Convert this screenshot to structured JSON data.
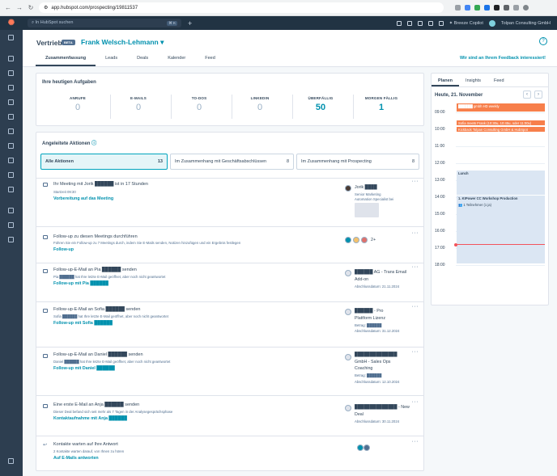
{
  "browser": {
    "url": "app.hubspot.com/prospecting/19811537"
  },
  "topbar": {
    "search_placeholder": "In HubSpot suchen",
    "search_kbd": "⌘ K",
    "copilot": "Breeze Copilot",
    "account": "Tolpan Consulting GmbH"
  },
  "header": {
    "title": "Vertrieb",
    "beta": "BETA",
    "owner": "Frank Welsch-Lehmann",
    "help": "?",
    "feedback": "Wir sind an Ihrem Feedback interessiert!",
    "tabs": [
      "Zusammenfassung",
      "Leads",
      "Deals",
      "Kalender",
      "Feed"
    ]
  },
  "tasks": {
    "title": "Ihre heutigen Aufgaben",
    "stats": [
      {
        "label": "ANRUFE",
        "value": "0"
      },
      {
        "label": "E-MAILS",
        "value": "0"
      },
      {
        "label": "TO-DOS",
        "value": "0"
      },
      {
        "label": "LINKEDIN",
        "value": "0"
      },
      {
        "label": "ÜBERFÄLLIG",
        "value": "50"
      },
      {
        "label": "MORGEN FÄLLIG",
        "value": "1"
      }
    ]
  },
  "actions": {
    "title": "Angeleitete Aktionen",
    "filters": [
      {
        "label": "Alle Aktionen",
        "count": "13"
      },
      {
        "label": "Im Zusammenhang mit Geschäftsabschlüssen",
        "count": "8"
      },
      {
        "label": "Im Zusammenhang mit Prospecting",
        "count": "8"
      }
    ],
    "rows": [
      {
        "title": "Ihr Meeting mit Jorik ██████ ist in 17 Stunden",
        "sub": "Startzeit 09:30",
        "link": "Vorbereitung auf das Meeting",
        "right": [
          "Jorik ████",
          "Senior Marketing",
          "Automation Specialist bei"
        ]
      },
      {
        "title": "Follow-up zu diesen Meetings durchführen",
        "sub": "Führen Sie ein Follow-up zu 7 Meetings durch, indem Sie E-Mails senden, Notizen hinzufügen und ein Ergebnis festlegen",
        "link": "Follow-up",
        "right": [
          "2+"
        ]
      },
      {
        "title": "Follow-up-E-Mail an Pia ██████ senden",
        "sub": "Pia ██████ hat Ihre letzte E-Mail geöffnet, aber noch nicht geantwortet",
        "link": "Follow-up mit Pia ██████",
        "right": [
          "██████ AG - Trans Email",
          "Add-on",
          "Abschlussdatum: 21.11.2024"
        ]
      },
      {
        "title": "Follow-up-E-Mail an Sofia ██████ senden",
        "sub": "Sofia ██████ hat Ihre letzte E-Mail geöffnet, aber noch nicht geantwortet",
        "link": "Follow-up mit Sofia ██████",
        "right": [
          "██████ - Pro",
          "Plattform Lizenz",
          "Betrag: ██████",
          "Abschlussdatum: 31.12.2024"
        ]
      },
      {
        "title": "Follow-up-E-Mail an Daniel ██████ senden",
        "sub": "Daniel ██████ hat Ihre letzte E-Mail geöffnet, aber noch nicht geantwortet",
        "link": "Follow-up mit Daniel ██████",
        "right": [
          "██████████████",
          "GmbH - Sales Ops",
          "Coaching",
          "Betrag: ██████",
          "Abschlussdatum: 12.10.2024"
        ]
      },
      {
        "title": "Eine erste E-Mail an Anja ██████ senden",
        "sub": "Dieser Deal befand sich seit mehr als 7 Tagen in der Analysegesprächsphase",
        "link": "Kontaktaufnahme mit Anja ██████",
        "right": [
          "██████████████ - New",
          "Deal",
          "Abschlussdatum: 30.11.2024"
        ]
      },
      {
        "title": "Kontakte warten auf Ihre Antwort",
        "sub": "2 Kontakte warten darauf, von Ihnen zu hören",
        "link": "Auf E-Mails antworten",
        "right": []
      }
    ]
  },
  "calendar": {
    "tabs": [
      "Planen",
      "Insights",
      "Feed"
    ],
    "date": "Heute, 21. November",
    "prev": "‹",
    "next": "›",
    "hours": [
      "09:00",
      "10:00",
      "11:00",
      "12:00",
      "13:00",
      "14:00",
      "15:00",
      "16:00",
      "17:00",
      "18:00"
    ],
    "events": [
      {
        "label": "██████ gmbh HD weekly"
      },
      {
        "label": "Sofia meets Frank (10:30u, 10:45u, oder 11:00u)"
      },
      {
        "label": "Kickback Tolpan Consulting GmbH & HubSpot"
      },
      {
        "label": "Lunch"
      },
      {
        "label": "1. KIPower CC Workshop Production"
      },
      {
        "label": "1 Teilnehmer (1 ja)"
      }
    ]
  },
  "colors": {
    "topbar": "#213343",
    "sidebar": "#2d3e50",
    "accent": "#0091ae",
    "event_orange": "#f77f4b",
    "event_blue": "#dbe6f3",
    "now": "#f2545b"
  }
}
